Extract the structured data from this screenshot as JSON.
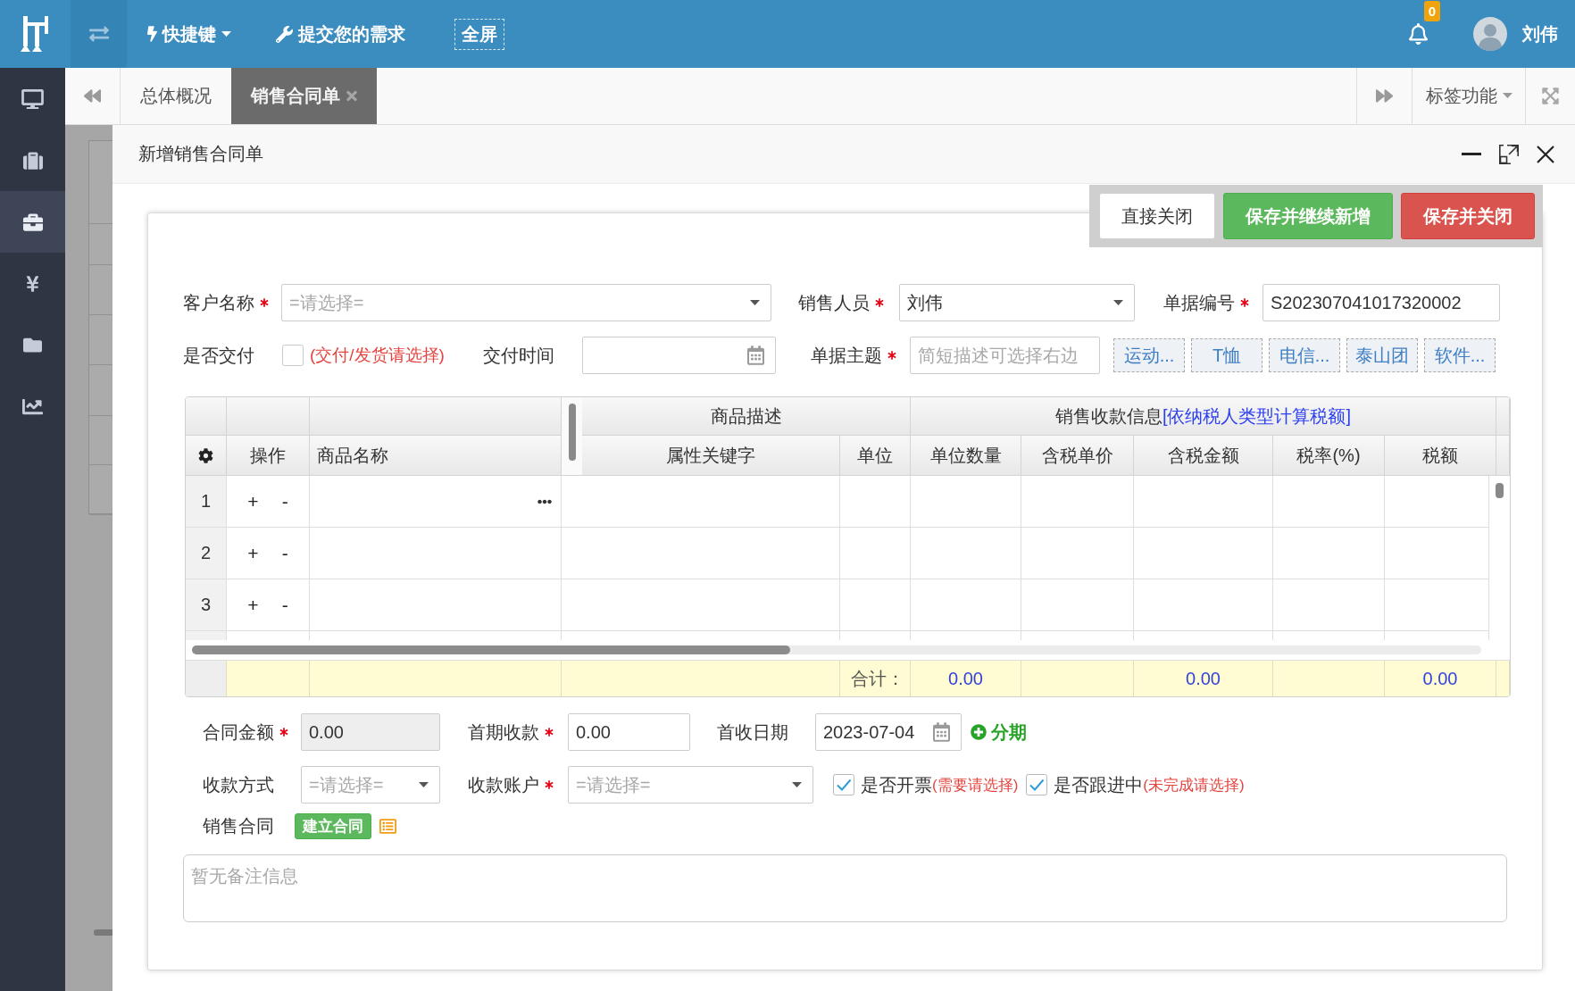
{
  "top_bar": {
    "shortcuts": {
      "label": "快捷键"
    },
    "feedback": {
      "label": "提交您的需求"
    },
    "fullscreen": {
      "label": "全屏"
    },
    "notification_count": "0",
    "user_name": "刘伟"
  },
  "sidebar": {
    "items": [
      {
        "selected": false
      },
      {
        "selected": false
      },
      {
        "selected": true
      },
      {
        "selected": false
      },
      {
        "selected": false
      },
      {
        "selected": false
      }
    ]
  },
  "tabs": [
    {
      "label": "总体概况",
      "selected": false,
      "closable": false
    },
    {
      "label": "销售合同单",
      "selected": true,
      "closable": true
    }
  ],
  "tab_menu": {
    "label": "标签功能"
  },
  "dialog": {
    "title": "新增销售合同单",
    "actions": [
      {
        "label": "直接关闭",
        "kind": "default"
      },
      {
        "label": "保存并继续新增",
        "kind": "success"
      },
      {
        "label": "保存并关闭",
        "kind": "danger"
      }
    ]
  },
  "form": {
    "customer": {
      "label": "客户名称",
      "required": true,
      "placeholder": "=请选择="
    },
    "salesperson": {
      "label": "销售人员",
      "required": true,
      "value": "刘伟"
    },
    "document_number": {
      "label": "单据编号",
      "required": true,
      "value": "S202307041017320002"
    },
    "delivered": {
      "label": "是否交付",
      "checked": false,
      "hint": "(交付/发货请选择)"
    },
    "delivery_time": {
      "label": "交付时间"
    },
    "subject": {
      "label": "单据主题",
      "required": true,
      "placeholder": "简短描述可选择右边"
    },
    "subject_tags": [
      "运动...",
      "T恤",
      "电信...",
      "泰山团",
      "软件..."
    ]
  },
  "table": {
    "groups": [
      {
        "label": "商品描述"
      },
      {
        "label": "销售收款信息",
        "note": "[依纳税人类型计算税额]"
      }
    ],
    "columns": [
      "操作",
      "商品名称",
      "属性关键字",
      "单位",
      "单位数量",
      "含税单价",
      "含税金额",
      "税率(%)",
      "税额"
    ],
    "rows": [
      {
        "number": "1",
        "ops": [
          "+",
          "-"
        ],
        "active": true
      },
      {
        "number": "2",
        "ops": [
          "+",
          "-"
        ],
        "active": false
      },
      {
        "number": "3",
        "ops": [
          "+",
          "-"
        ],
        "active": false
      }
    ],
    "totals": {
      "label": "合计：",
      "unit_quantity": "0.00",
      "amount_with_tax": "0.00",
      "tax": "0.00"
    }
  },
  "payment": {
    "contract_amount": {
      "label": "合同金额",
      "required": true,
      "value": "0.00",
      "readonly": true
    },
    "first_payment": {
      "label": "首期收款",
      "required": true,
      "value": "0.00",
      "readonly": false
    },
    "first_payment_date": {
      "label": "首收日期",
      "value": "2023-07-04"
    },
    "installments": {
      "label": "分期"
    },
    "payment_method": {
      "label": "收款方式",
      "placeholder": "=请选择="
    },
    "account": {
      "label": "收款账户",
      "required": true,
      "placeholder": "=请选择="
    },
    "invoice": {
      "label": "是否开票",
      "checked": true,
      "hint": "(需要请选择)"
    },
    "follow_up": {
      "label": "是否跟进中",
      "checked": true,
      "hint": "(未完成请选择)"
    },
    "contract": {
      "label": "销售合同",
      "button": "建立合同"
    }
  },
  "remarks": {
    "placeholder": "暂无备注信息"
  }
}
